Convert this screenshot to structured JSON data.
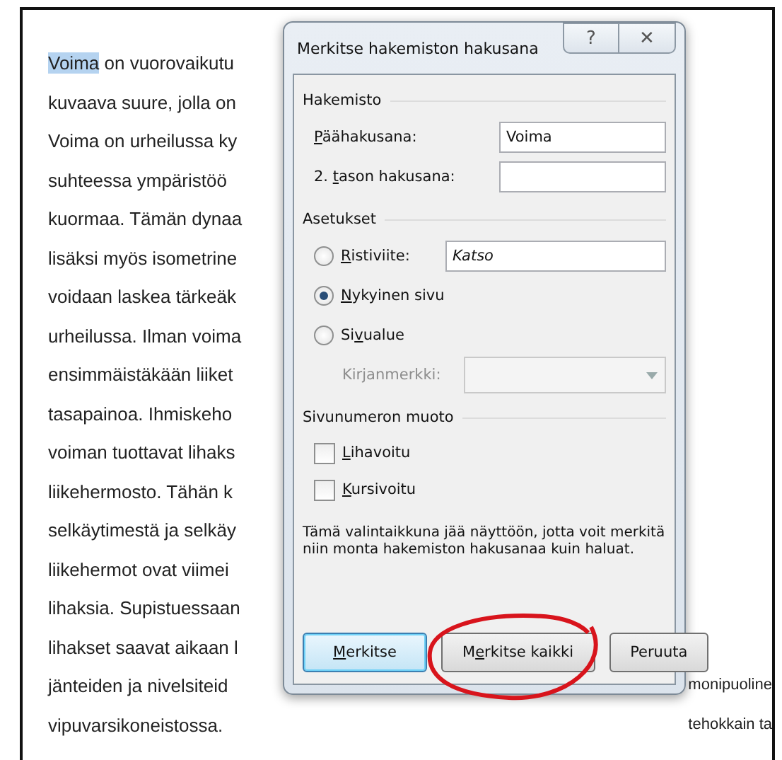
{
  "document": {
    "left_lines": [
      {
        "highlight": "Voima",
        "text": " on vuorovaikutu"
      },
      {
        "text": "kuvaava suure, jolla on"
      },
      {
        "text": "Voima on urheilussa ky"
      },
      {
        "text": "suhteessa ympäristöö"
      },
      {
        "text": "kuormaa. Tämän dynaa"
      },
      {
        "text": "lisäksi myös isometrine"
      },
      {
        "text": "voidaan laskea tärkeäk"
      },
      {
        "text": "urheilussa. Ilman voima"
      },
      {
        "text": "ensimmäistäkään liiket"
      },
      {
        "text": "tasapainoa. Ihmiskeho"
      },
      {
        "text": "voiman tuottavat lihaks"
      },
      {
        "text": "liikehermosto. Tähän k"
      },
      {
        "text": "selkäytimestä ja selkäy"
      },
      {
        "text": "liikehermot ovat viimei"
      },
      {
        "text": "lihaksia. Supistuessaan"
      },
      {
        "text": "lihakset saavat aikaan l"
      },
      {
        "text": "jänteiden ja nivelsiteid"
      },
      {
        "text": "vipuvarsikoneistossa."
      }
    ],
    "right_lines": [
      "monipuoline",
      "tehokkain ta"
    ]
  },
  "dialog": {
    "title": "Merkitse hakemiston hakusana",
    "help": "?",
    "close": "✕",
    "groups": [
      {
        "title": "Hakemisto",
        "items": [
          {
            "kind": "field",
            "access_key": "P",
            "label_end": "äähakusana:",
            "value": "Voima"
          },
          {
            "kind": "field",
            "label_start": "2. ",
            "access_key": "t",
            "label_end": "ason hakusana:",
            "value": ""
          }
        ]
      },
      {
        "title": "Asetukset",
        "items": [
          {
            "kind": "radio-field",
            "access_key": "R",
            "label_end": "istiviite:",
            "selected": false,
            "value": "Katso"
          },
          {
            "kind": "radio",
            "access_key": "N",
            "label_end": "ykyinen sivu",
            "selected": true
          },
          {
            "kind": "radio",
            "label_start": "Si",
            "access_key": "v",
            "label_end": "ualue",
            "selected": false
          },
          {
            "kind": "dropdown",
            "label": "Kirjanmerkki:",
            "disabled": true
          }
        ]
      },
      {
        "title": "Sivunumeron muoto",
        "items": [
          {
            "kind": "checkbox",
            "access_key": "L",
            "label_end": "ihavoitu",
            "checked": false
          },
          {
            "kind": "checkbox",
            "access_key": "K",
            "label_end": "ursivoitu",
            "checked": false
          }
        ]
      }
    ],
    "note": "Tämä valintaikkuna jää näyttöön, jotta voit merkitä niin monta hakemiston hakusanaa kuin haluat.",
    "buttons": [
      {
        "access_key": "M",
        "label_end": "erkitse",
        "default": true,
        "circled": false
      },
      {
        "label_start": "M",
        "access_key": "e",
        "label_end": "rkitse kaikki",
        "default": false,
        "circled": true
      },
      {
        "label_start": "Peruuta",
        "default": false,
        "circled": false
      }
    ]
  }
}
